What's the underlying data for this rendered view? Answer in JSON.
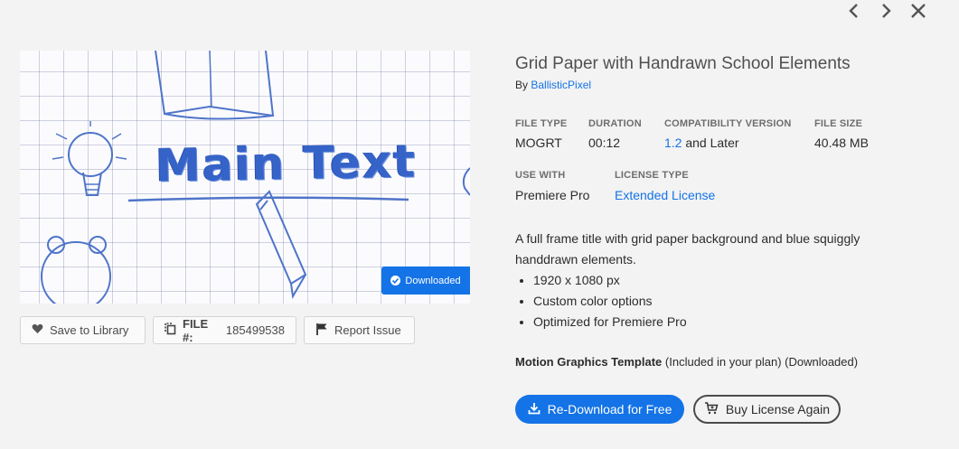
{
  "nav": {
    "prev_icon": "chevron-left-icon",
    "next_icon": "chevron-right-icon",
    "close_icon": "close-icon"
  },
  "preview": {
    "main_text": "Main Text",
    "badge": "Downloaded"
  },
  "actions": {
    "save_label": "Save to Library",
    "file_label": "FILE #:",
    "file_number": "185499538",
    "report_label": "Report Issue"
  },
  "asset": {
    "title": "Grid Paper with Handrawn School Elements",
    "by_prefix": "By",
    "author": "BallisticPixel"
  },
  "meta": {
    "file_type_label": "FILE TYPE",
    "file_type": "MOGRT",
    "duration_label": "DURATION",
    "duration": "00:12",
    "compat_label": "COMPATIBILITY VERSION",
    "compat_version": "1.2",
    "compat_suffix": "and Later",
    "size_label": "FILE SIZE",
    "size": "40.48 MB",
    "use_with_label": "USE WITH",
    "use_with": "Premiere Pro",
    "license_label": "LICENSE TYPE",
    "license": "Extended License"
  },
  "description": {
    "text": "A full frame title with grid paper background and blue squiggly handdrawn elements.",
    "bullets": [
      "1920 x 1080 px",
      "Custom color options",
      "Optimized for Premiere Pro"
    ]
  },
  "plan": {
    "type": "Motion Graphics Template",
    "note": "(Included in your plan) (Downloaded)"
  },
  "buttons": {
    "redownload": "Re-Download for Free",
    "buy_again": "Buy License Again"
  },
  "colors": {
    "accent": "#1473e6",
    "background": "#f3f3f3"
  }
}
